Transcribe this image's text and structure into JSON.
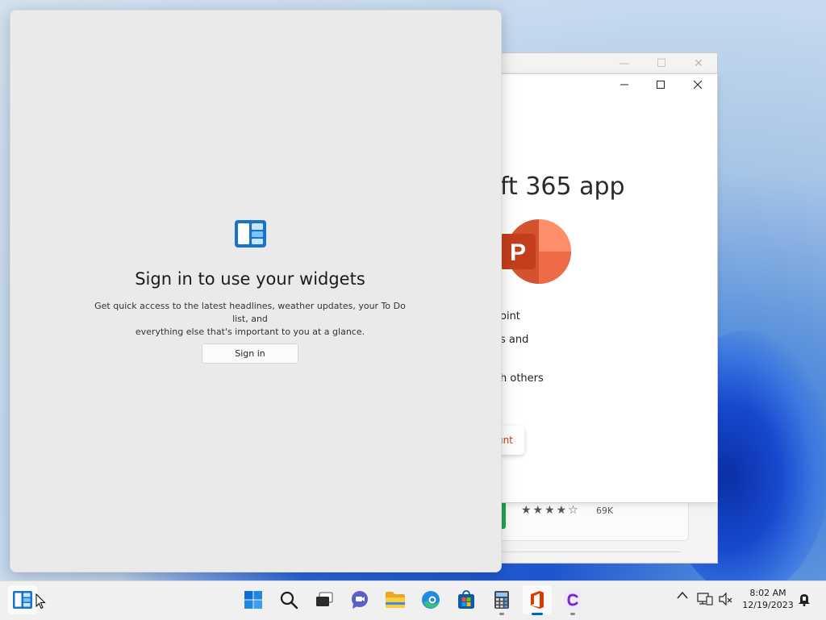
{
  "widgets": {
    "title": "Sign in to use your widgets",
    "description_line1": "Get quick access to the latest headlines, weather updates, your To Do list, and",
    "description_line2": "everything else that's important to you at a glance.",
    "signin_label": "Sign in"
  },
  "store_window": {
    "heading_partial": "ft 365 app",
    "features": [
      "oint",
      "s and",
      "h others"
    ],
    "account_button_partial": "unt",
    "rating_stars": "★★★★☆",
    "rating_value": 4,
    "rating_count": "69K",
    "controls": {
      "minimize_glyph": "—",
      "maximize_glyph": "☐",
      "close_glyph": "✕"
    }
  },
  "taskbar": {
    "icons": [
      {
        "name": "widgets-icon",
        "active": true
      },
      {
        "name": "start-icon"
      },
      {
        "name": "search-icon"
      },
      {
        "name": "task-view-icon"
      },
      {
        "name": "chat-icon"
      },
      {
        "name": "file-explorer-icon"
      },
      {
        "name": "edge-icon"
      },
      {
        "name": "microsoft-store-icon"
      },
      {
        "name": "calculator-icon",
        "running": true
      },
      {
        "name": "office-icon",
        "running": true,
        "active": true
      },
      {
        "name": "clipchamp-icon",
        "running": true
      }
    ],
    "tray": {
      "chevron": "^",
      "time": "8:02 AM",
      "date": "12/19/2023"
    }
  },
  "colors": {
    "accent": "#0067c0",
    "office_red": "#c43e1c",
    "widgets_bg": "#eaeaea",
    "taskbar_bg": "#f0f0f0"
  }
}
